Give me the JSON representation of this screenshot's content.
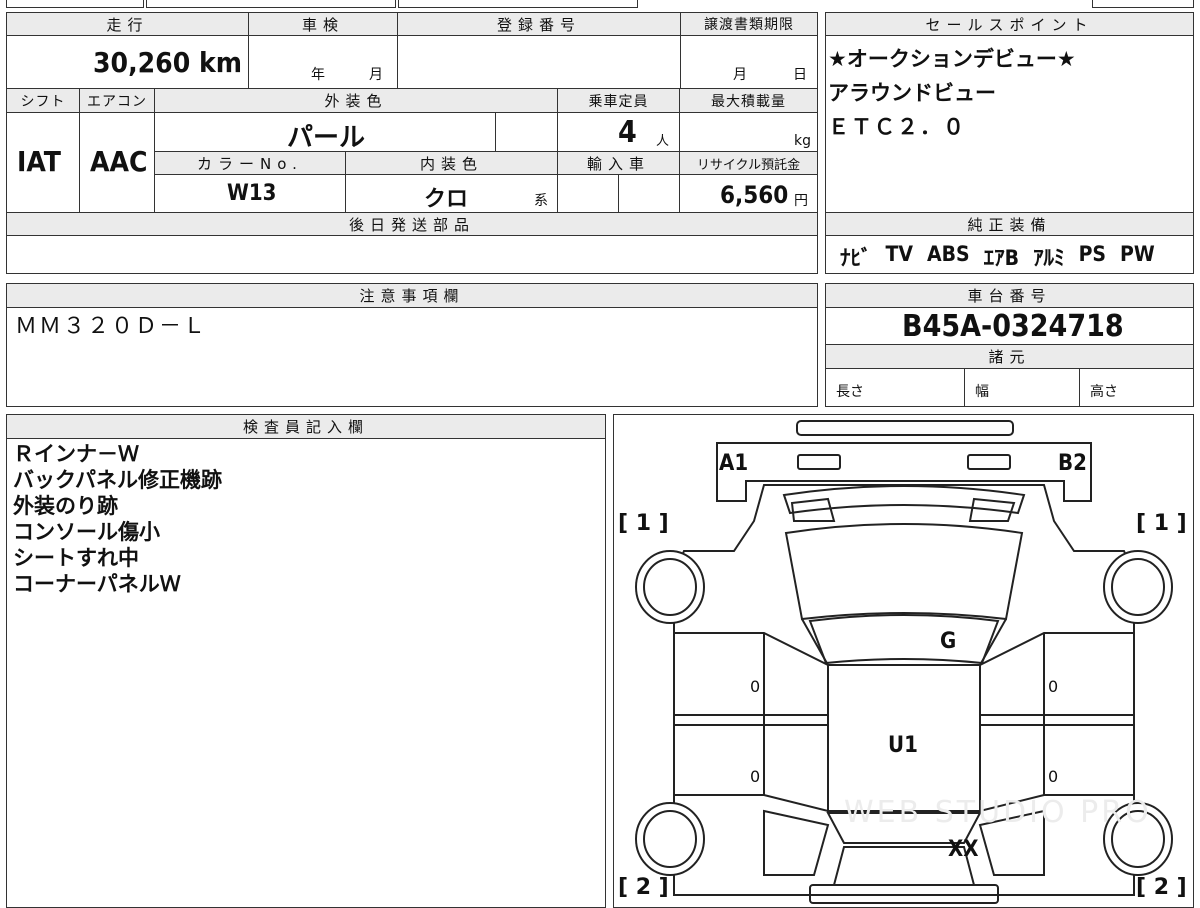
{
  "header": {
    "mileage_label": "走行",
    "shaken_label": "車検",
    "reg_number_label": "登録番号",
    "transfer_deadline_label": "譲渡書類期限",
    "mileage_value": "30,260 km",
    "shaken_year_unit": "年",
    "shaken_month_unit": "月",
    "deadline_month_unit": "月",
    "deadline_day_unit": "日"
  },
  "specs": {
    "shift_label": "シフト",
    "aircon_label": "エアコン",
    "exterior_color_label": "外装色",
    "capacity_label": "乗車定員",
    "max_load_label": "最大積載量",
    "shift_value": "IAT",
    "aircon_value": "AAC",
    "exterior_color_value": "パール",
    "capacity_value": "4",
    "capacity_unit": "人",
    "max_load_unit": "kg",
    "color_no_label": "カラーNo.",
    "interior_color_label": "内装色",
    "import_label": "輸入車",
    "recycle_label": "リサイクル預託金",
    "color_no_value": "W13",
    "interior_color_value": "クロ",
    "interior_color_suffix": "系",
    "recycle_value": "6,560",
    "recycle_unit": "円"
  },
  "later_parts": {
    "label": "後日発送部品",
    "value": ""
  },
  "sales_points": {
    "label": "セールスポイント",
    "lines": [
      "★オークションデビュー★",
      "アラウンドビュー",
      "ＥＴＣ２．０"
    ]
  },
  "genuine_equipment": {
    "label": "純正装備",
    "items": [
      "ﾅﾋﾞ",
      "TV",
      "ABS",
      "ｴｱB",
      "ｱﾙﾐ",
      "PS",
      "PW"
    ]
  },
  "notes": {
    "label": "注意事項欄",
    "value": "ＭＭ３２０Ｄ－Ｌ"
  },
  "chassis": {
    "label": "車台番号",
    "value": "B45A-0324718"
  },
  "dimensions": {
    "label": "諸元",
    "length_label": "長さ",
    "width_label": "幅",
    "height_label": "高さ"
  },
  "inspector": {
    "label": "検査員記入欄",
    "lines": [
      "Ｒインナ－Ｗ",
      "バックパネル修正機跡",
      "外装のり跡",
      "コンソール傷小",
      "シートすれ中",
      "コーナーパネルＷ"
    ]
  },
  "diagram": {
    "mark_a1": "A1",
    "mark_b2": "B2",
    "mark_g": "G",
    "mark_u1": "U1",
    "mark_xx": "XX",
    "bracket_fl": "[ 1 ]",
    "bracket_fr": "[ 1 ]",
    "bracket_rl": "[ 2 ]",
    "bracket_rr": "[ 2 ]",
    "left_door_front": "0",
    "left_door_rear": "0",
    "right_door_front": "0",
    "right_door_rear": "0",
    "watermark": "WEB STUDIO PRO"
  }
}
